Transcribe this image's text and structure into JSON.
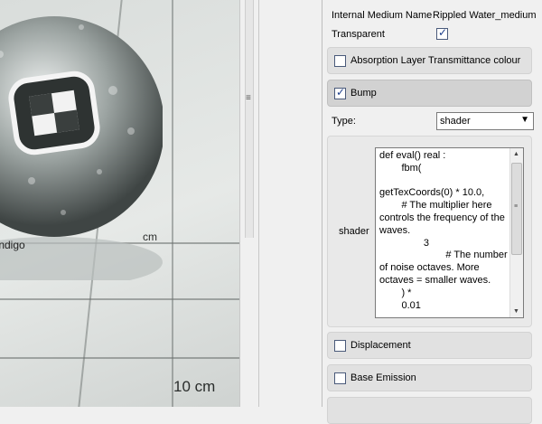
{
  "viewport": {
    "ruler_labels": [
      "cm",
      "10 cm"
    ],
    "logo_text": "Indigo"
  },
  "splitter": {
    "grip": "≡"
  },
  "properties": {
    "internal_medium": {
      "label": "Internal Medium Name",
      "value": "Rippled Water_medium"
    },
    "transparent": {
      "label": "Transparent",
      "checked": true
    },
    "sections": [
      {
        "label": "Absorption Layer Transmittance colour",
        "checked": false
      },
      {
        "label": "Bump",
        "checked": true
      },
      {
        "label": "Displacement",
        "checked": false
      },
      {
        "label": "Base Emission",
        "checked": false
      }
    ],
    "type": {
      "label": "Type:",
      "value": "shader",
      "arrow": "▼"
    },
    "shader": {
      "label": "shader",
      "code": "def eval() real :\n        fbm(\n\ngetTexCoords(0) * 10.0,\n        # The multiplier here controls the frequency of the waves.\n                3\n                        # The number of noise octaves. More octaves = smaller waves.\n        ) *\n        0.01",
      "scroll_up": "▲",
      "scroll_down": "▼",
      "scroll_grip": "≡"
    }
  }
}
